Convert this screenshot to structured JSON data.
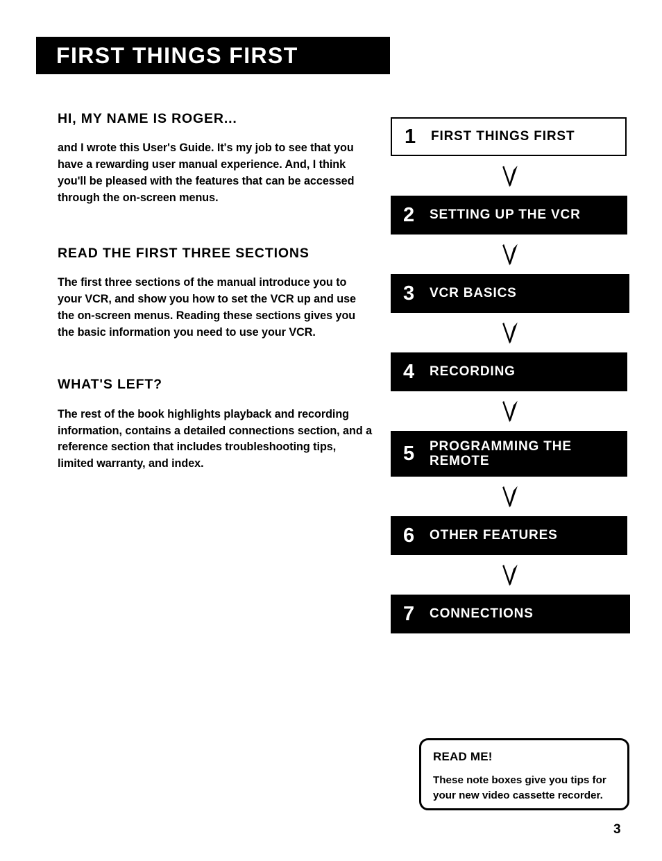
{
  "page": {
    "title_banner": "FIRST THINGS FIRST",
    "page_number": "3"
  },
  "left_column": {
    "sections": [
      {
        "heading": "HI, MY NAME IS ROGER...",
        "body": "and I wrote this User's Guide. It's my job to see that you have a rewarding user manual experience. And, I think you'll be pleased with the features that can be accessed through the on-screen menus."
      },
      {
        "heading": "READ THE FIRST THREE SECTIONS",
        "body": "The first three sections of the manual introduce you to your VCR, and show you how to set the VCR up and use the on-screen menus. Reading these sections gives you the basic information you need to use your VCR."
      },
      {
        "heading": "WHAT'S LEFT?",
        "body": "The rest of the book highlights playback and recording information, contains a detailed connections section, and a reference section that includes troubleshooting tips, limited warranty, and index."
      }
    ]
  },
  "flowchart": {
    "steps": [
      {
        "number": "1",
        "label": "FIRST THINGS FIRST",
        "current": true
      },
      {
        "number": "2",
        "label": "SETTING UP THE VCR",
        "current": false
      },
      {
        "number": "3",
        "label": "VCR BASICS",
        "current": false
      },
      {
        "number": "4",
        "label": "RECORDING",
        "current": false
      },
      {
        "number": "5",
        "label": "PROGRAMMING THE REMOTE",
        "current": false
      },
      {
        "number": "6",
        "label": "OTHER FEATURES",
        "current": false
      },
      {
        "number": "7",
        "label": "CONNECTIONS",
        "current": false
      }
    ],
    "connector_icon": "down-arrow-icon",
    "colors": {
      "box_fill": "#000000",
      "box_text": "#ffffff",
      "current_fill": "#ffffff",
      "current_text": "#000000"
    }
  },
  "note_box": {
    "title": "READ ME!",
    "body": "These note boxes give you tips for your new video cassette recorder."
  }
}
